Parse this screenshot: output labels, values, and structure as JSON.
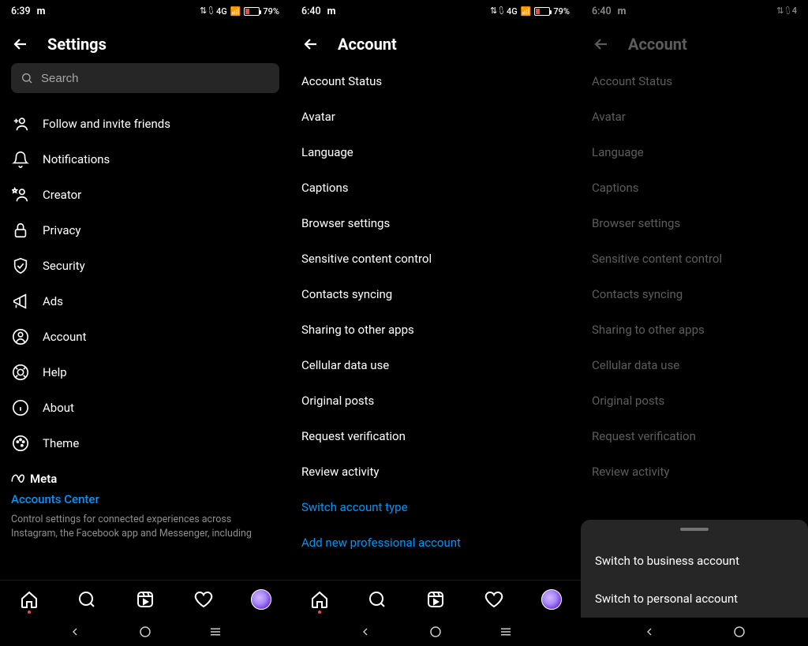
{
  "status": {
    "time1": "6:39",
    "time2": "6:40",
    "time3": "6:40",
    "carrier_icon": "m",
    "network": "4G",
    "battery_text": "79%"
  },
  "screen1": {
    "title": "Settings",
    "search_placeholder": "Search",
    "items": [
      "Follow and invite friends",
      "Notifications",
      "Creator",
      "Privacy",
      "Security",
      "Ads",
      "Account",
      "Help",
      "About",
      "Theme"
    ],
    "meta_label": "Meta",
    "accounts_center": "Accounts Center",
    "meta_desc": "Control settings for connected experiences across Instagram, the Facebook app and Messenger, including"
  },
  "screen2": {
    "title": "Account",
    "items": [
      "Account Status",
      "Avatar",
      "Language",
      "Captions",
      "Browser settings",
      "Sensitive content control",
      "Contacts syncing",
      "Sharing to other apps",
      "Cellular data use",
      "Original posts",
      "Request verification",
      "Review activity"
    ],
    "links": [
      "Switch account type",
      "Add new professional account"
    ]
  },
  "screen3": {
    "title": "Account",
    "items": [
      "Account Status",
      "Avatar",
      "Language",
      "Captions",
      "Browser settings",
      "Sensitive content control",
      "Contacts syncing",
      "Sharing to other apps",
      "Cellular data use",
      "Original posts",
      "Request verification",
      "Review activity"
    ],
    "sheet": {
      "option1": "Switch to business account",
      "option2": "Switch to personal account"
    }
  }
}
